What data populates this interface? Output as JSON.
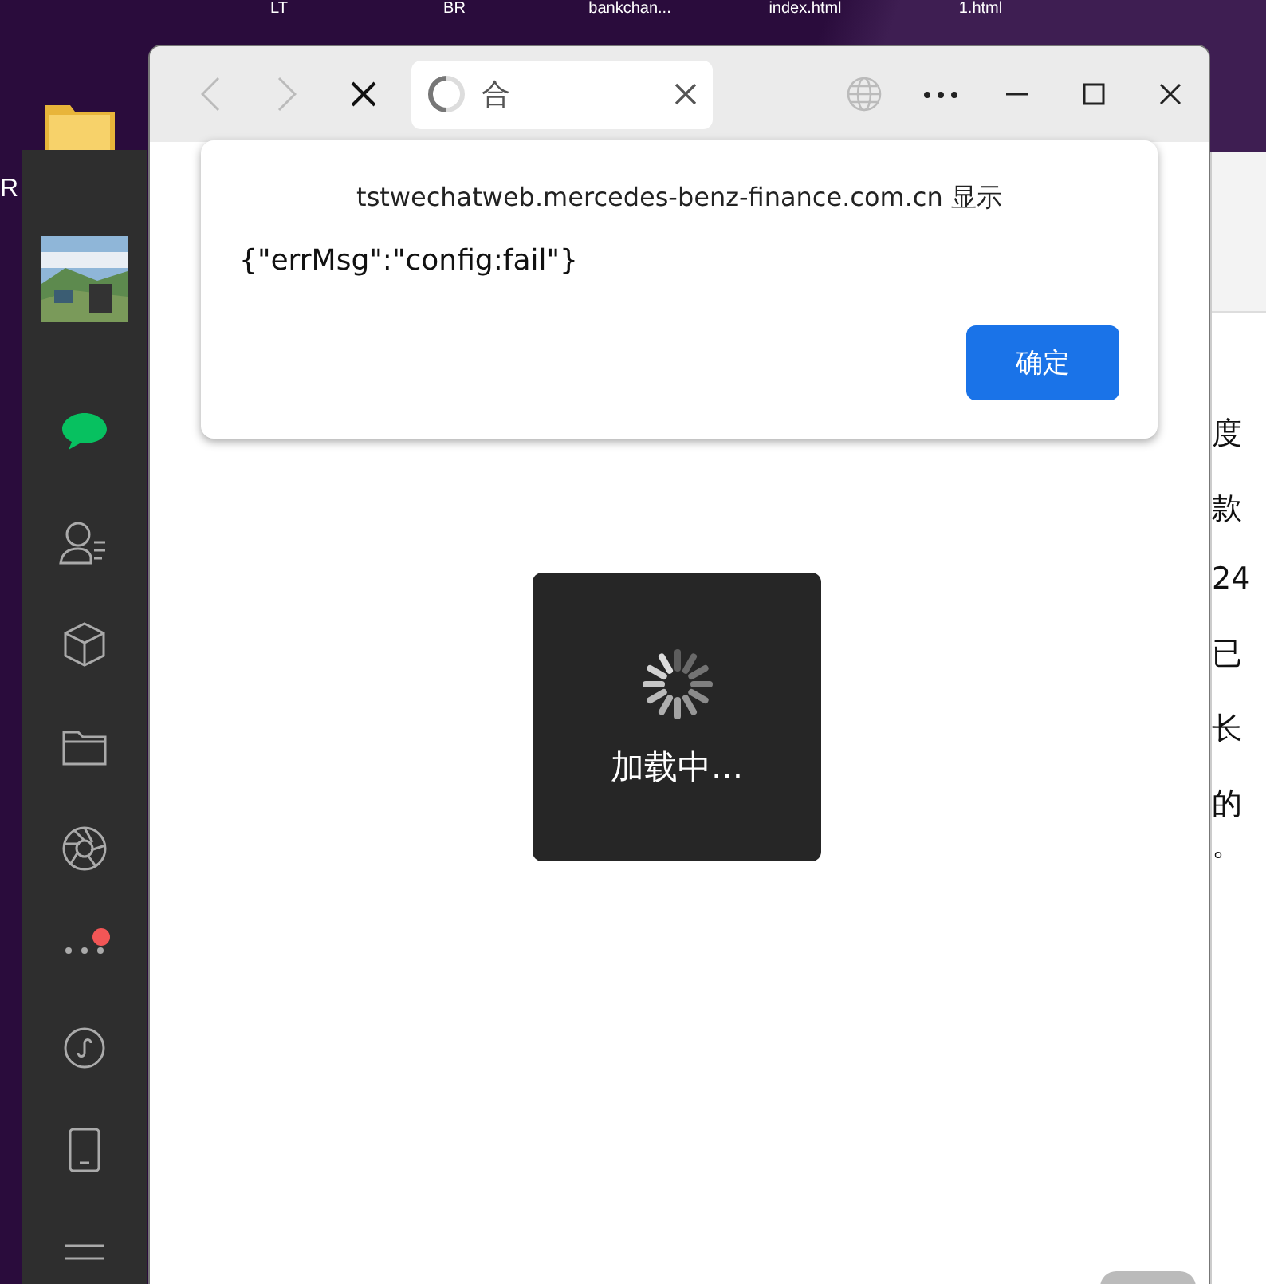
{
  "desktop": {
    "icons": [
      {
        "label": "LT"
      },
      {
        "label": "BR"
      },
      {
        "label": "bankchan..."
      },
      {
        "label": "index.html"
      },
      {
        "label": "1.html"
      }
    ],
    "edge_label": "R"
  },
  "sidebar": {
    "items": [
      {
        "kind": "chat",
        "selected": true,
        "badge": false
      },
      {
        "kind": "contacts",
        "selected": false,
        "badge": false
      },
      {
        "kind": "cube",
        "selected": false,
        "badge": false
      },
      {
        "kind": "folder",
        "selected": false,
        "badge": false
      },
      {
        "kind": "aperture",
        "selected": false,
        "badge": false
      },
      {
        "kind": "more",
        "selected": false,
        "badge": true
      }
    ],
    "bottom_items": [
      {
        "kind": "link"
      },
      {
        "kind": "phone"
      },
      {
        "kind": "menu"
      }
    ]
  },
  "background_window": {
    "lines": [
      "度",
      "款",
      "24",
      "已",
      "长",
      "的",
      "。"
    ]
  },
  "browser": {
    "tab": {
      "title": "合",
      "loading": true
    }
  },
  "dialog": {
    "origin": "tstwechatweb.mercedes-benz-finance.com.cn 显示",
    "message": "{\"errMsg\":\"config:fail\"}",
    "button": "确定"
  },
  "toast": {
    "text": "加载中..."
  }
}
